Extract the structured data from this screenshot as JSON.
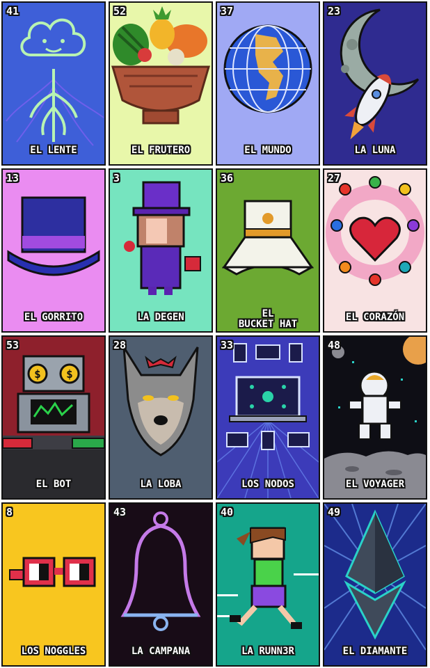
{
  "cards": [
    {
      "number": "41",
      "name": "EL LENTE",
      "bg": "#3b5fd6",
      "icon": "cloud-tree-icon"
    },
    {
      "number": "52",
      "name": "EL FRUTERO",
      "bg": "#e6f5a8",
      "icon": "fruit-bowl-icon"
    },
    {
      "number": "37",
      "name": "EL MUNDO",
      "bg": "#9fa8f3",
      "icon": "globe-icon"
    },
    {
      "number": "23",
      "name": "LA LUNA",
      "bg": "#2e2a8f",
      "icon": "moon-rocket-icon"
    },
    {
      "number": "13",
      "name": "EL GORRITO",
      "bg": "#e98af0",
      "icon": "top-hat-icon"
    },
    {
      "number": "3",
      "name": "LA DEGEN",
      "bg": "#74e3be",
      "icon": "degen-character-icon"
    },
    {
      "number": "36",
      "name": "EL\nBUCKET HAT",
      "bg": "#6aa830",
      "icon": "bucket-hat-icon"
    },
    {
      "number": "27",
      "name": "EL CORAZÓN",
      "bg": "#f8e2e2",
      "icon": "heart-people-icon"
    },
    {
      "number": "53",
      "name": "EL BOT",
      "bg": "#8d1f2b",
      "icon": "trading-bot-icon"
    },
    {
      "number": "28",
      "name": "LA LOBA",
      "bg": "#4d5c6e",
      "icon": "wolf-icon"
    },
    {
      "number": "33",
      "name": "LOS NODOS",
      "bg": "#3b3ab8",
      "icon": "network-nodes-icon"
    },
    {
      "number": "48",
      "name": "EL VOYAGER",
      "bg": "#0d0d14",
      "icon": "astronaut-icon"
    },
    {
      "number": "8",
      "name": "LOS NOGGLES",
      "bg": "#f7c51e",
      "icon": "noggles-glasses-icon"
    },
    {
      "number": "43",
      "name": "LA CAMPANA",
      "bg": "#170b16",
      "icon": "bell-icon"
    },
    {
      "number": "40",
      "name": "LA RUNN3R",
      "bg": "#14a48a",
      "icon": "runner-girl-icon"
    },
    {
      "number": "49",
      "name": "EL DIAMANTE",
      "bg": "#1b2a8a",
      "icon": "ethereum-diamond-icon"
    }
  ]
}
